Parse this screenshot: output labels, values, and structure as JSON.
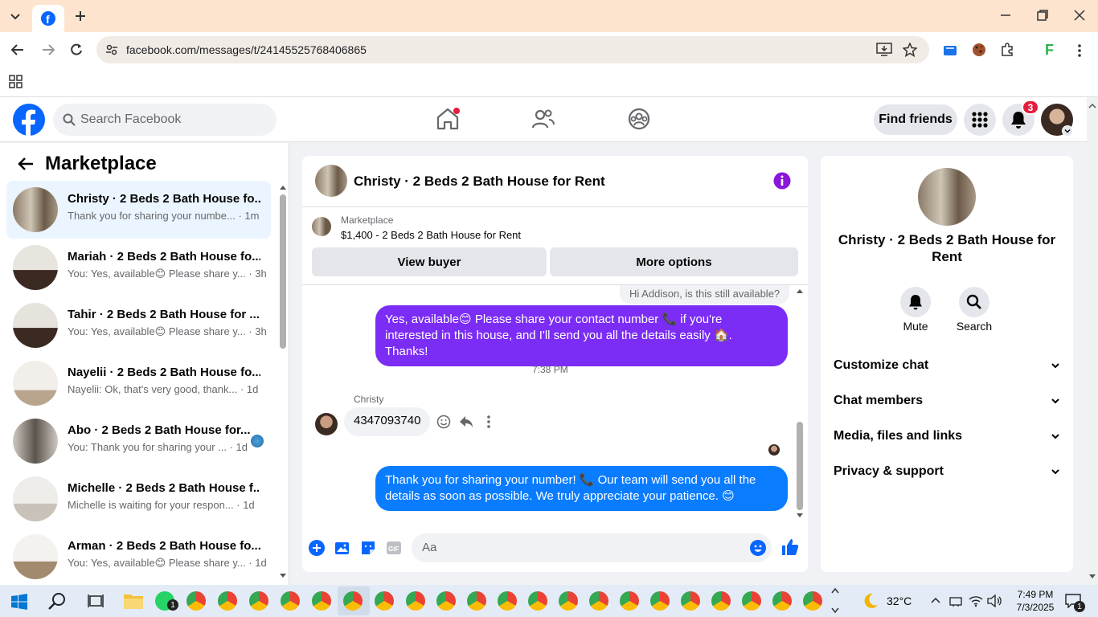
{
  "browser": {
    "url": "facebook.com/messages/t/24145525768406865",
    "tab_title": "Facebook"
  },
  "header": {
    "search_placeholder": "Search Facebook",
    "find_friends": "Find friends",
    "notification_count": "3"
  },
  "sidebar": {
    "title": "Marketplace",
    "conversations": [
      {
        "title": "Christy · 2 Beds 2 Bath House fo...",
        "snippet": "Thank you for sharing your numbe... · 1m",
        "active": true
      },
      {
        "title": "Mariah · 2 Beds 2 Bath House fo...",
        "snippet": "You: Yes, available😊 Please share y... · 3h"
      },
      {
        "title": "Tahir · 2 Beds 2 Bath House for ...",
        "snippet": "You: Yes, available😊 Please share y... · 3h"
      },
      {
        "title": "Nayelii · 2 Beds 2 Bath House fo...",
        "snippet": "Nayelii: Ok, that's very good, thank... · 1d"
      },
      {
        "title": "Abo · 2 Beds 2 Bath House for...",
        "snippet": "You: Thank you for sharing your ... · 1d"
      },
      {
        "title": "Michelle · 2 Beds 2 Bath House f...",
        "snippet": "Michelle is waiting for your respon... · 1d"
      },
      {
        "title": "Arman · 2 Beds 2 Bath House fo...",
        "snippet": "You: Yes, available😊 Please share y... · 1d"
      }
    ]
  },
  "chat": {
    "title": "Christy · 2 Beds 2 Bath House for Rent",
    "listing_source": "Marketplace",
    "listing_title": "$1,400 - 2 Beds 2 Bath House for Rent",
    "view_buyer": "View buyer",
    "more_options": "More options",
    "messages": {
      "incoming_faded": "Hi Addison, is this still available?",
      "outgoing_1": "Yes, available😊 Please share your contact number 📞 if you're interested in this house, and I'll send you all the details easily 🏠. Thanks!",
      "timestamp": "7:38 PM",
      "sender_name": "Christy",
      "incoming_1": "4347093740",
      "outgoing_2": "Thank you for sharing your number! 📞 Our team will send you all the details as soon as possible. We truly appreciate your patience. 😊"
    },
    "composer_placeholder": "Aa"
  },
  "details": {
    "title": "Christy · 2 Beds 2 Bath House for Rent",
    "mute": "Mute",
    "search": "Search",
    "sections": [
      "Customize chat",
      "Chat members",
      "Media, files and links",
      "Privacy & support"
    ]
  },
  "taskbar": {
    "temperature": "32°C",
    "time": "7:49 PM",
    "date": "7/3/2025",
    "notification_badge": "1"
  },
  "colors": {
    "fb_blue": "#0866ff",
    "outgoing_purple": "#7b2cf5",
    "outgoing_blue": "#0a7cff",
    "info_purple": "#8a16d9"
  }
}
